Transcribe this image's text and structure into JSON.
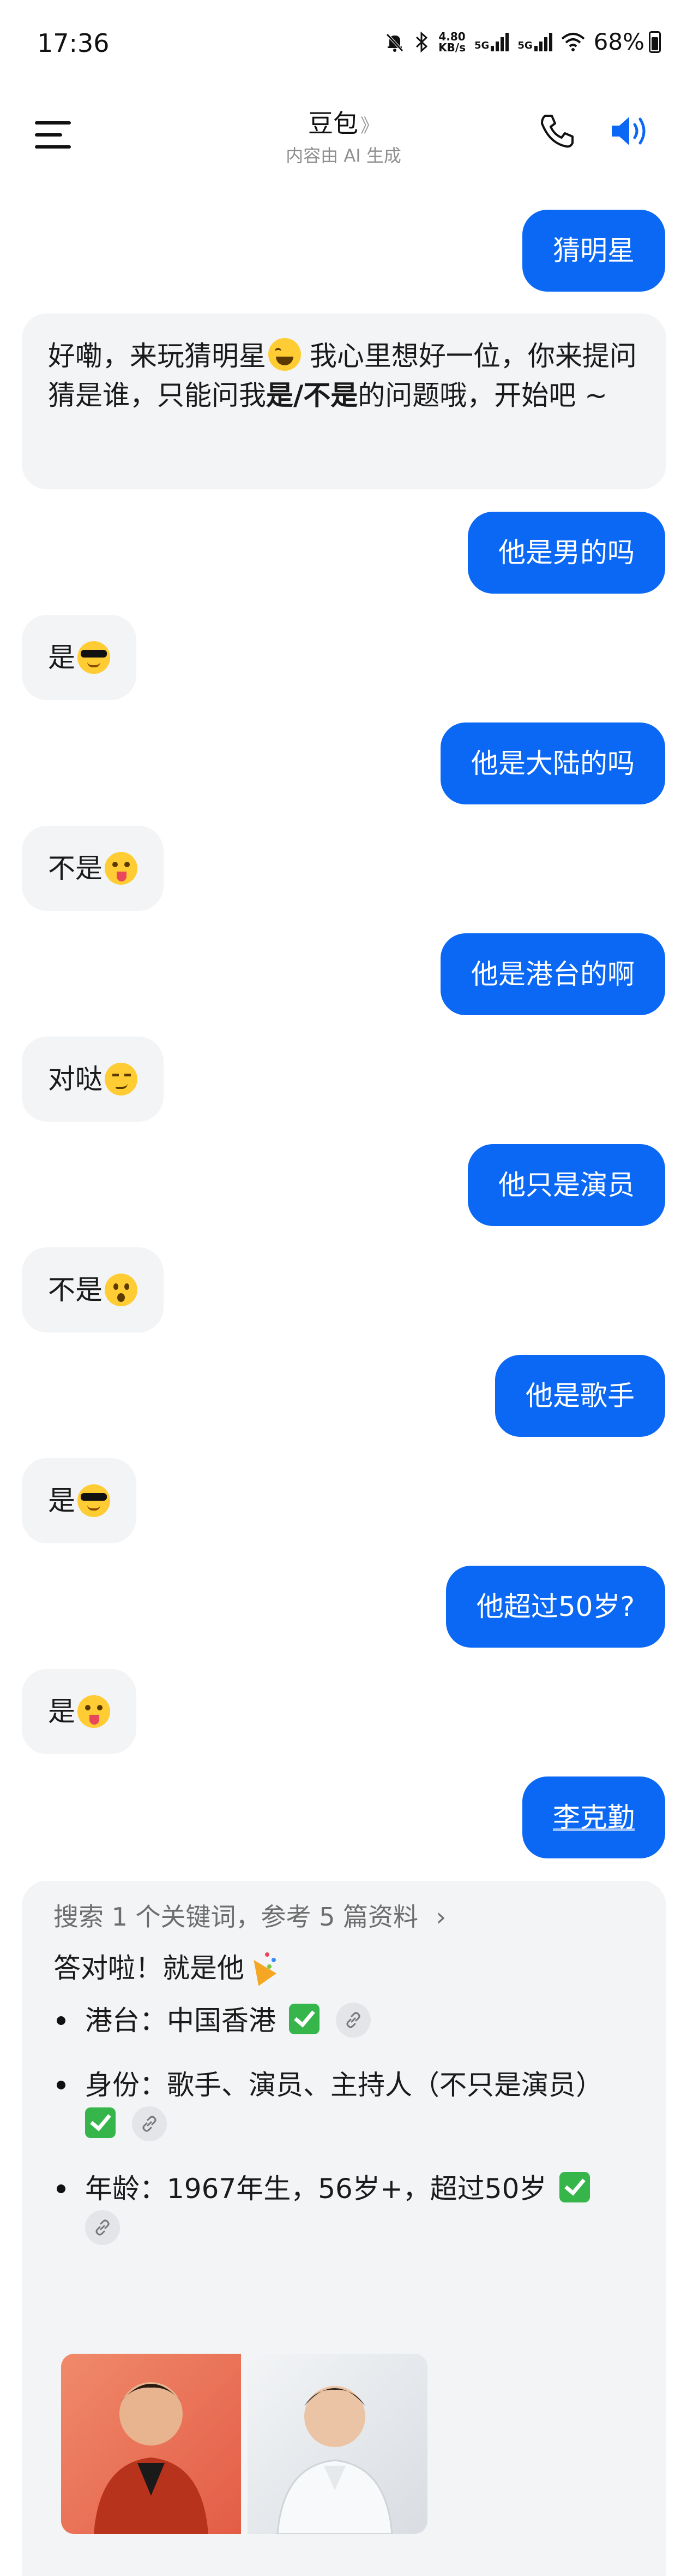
{
  "status_bar": {
    "time": "17:36",
    "net_speed_value": "4.80",
    "net_speed_unit": "KB/s",
    "signal1_label": "5G",
    "signal2_label": "5G",
    "battery": "68%"
  },
  "header": {
    "title": "豆包",
    "title_chevron": "》",
    "subtitle": "内容由 AI 生成"
  },
  "messages": {
    "m1_user": "猜明星",
    "m2_bot_part1": "好嘞，来玩猜明星",
    "m2_bot_part2": " 我心里想好一位，你来提问猜是谁，只能问我",
    "m2_bot_bold": "是/不是",
    "m2_bot_part3": "的问题哦，开始吧 ~",
    "m3_user": "他是男的吗",
    "m4_bot": "是",
    "m5_user": "他是大陆的吗",
    "m6_bot": "不是",
    "m7_user": "他是港台的啊",
    "m8_bot": "对哒",
    "m9_user": "他只是演员",
    "m10_bot": "不是",
    "m11_user": "他是歌手",
    "m12_bot": "是",
    "m13_user": "他超过50岁?",
    "m14_bot": "是",
    "m15_user": "李克勤"
  },
  "answer": {
    "search_summary": "搜索 1 个关键词，参考 5 篇资料",
    "search_chevron": "›",
    "intro": "答对啦！就是他",
    "bullets": [
      {
        "text": "港台：中国香港"
      },
      {
        "text": "身份：歌手、演员、主持人（不只是演员）"
      },
      {
        "text": "年龄：1967年生，56岁+，超过50岁"
      }
    ]
  },
  "colors": {
    "user_bubble": "#0a68f5",
    "bot_bubble": "#f3f4f6",
    "accent_icon": "#0a68f5"
  },
  "icons": [
    "menu-icon",
    "phone-icon",
    "speaker-icon",
    "link-icon",
    "check-icon"
  ]
}
